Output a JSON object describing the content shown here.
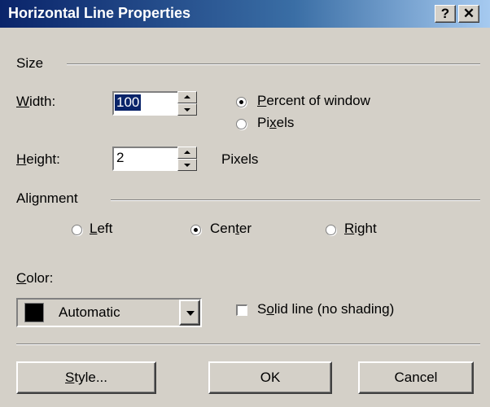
{
  "window": {
    "title": "Horizontal Line Properties",
    "help_label": "?",
    "close_label": "✕"
  },
  "size": {
    "section_label": "Size",
    "width_label_ul": "W",
    "width_label_rest": "idth:",
    "width_value": "100",
    "percent_ul": "P",
    "percent_rest": "ercent of window",
    "pixels_pre": "Pi",
    "pixels_ul": "x",
    "pixels_post": "els",
    "height_label_ul": "H",
    "height_label_rest": "eight:",
    "height_value": "2",
    "height_unit": "Pixels",
    "selected_unit": "percent"
  },
  "alignment": {
    "section_label": "Alignment",
    "left_ul": "L",
    "left_rest": "eft",
    "center_pre": "Cen",
    "center_ul": "t",
    "center_post": "er",
    "right_ul": "R",
    "right_rest": "ight",
    "selected": "center"
  },
  "color": {
    "label_ul": "C",
    "label_rest": "olor:",
    "value": "Automatic",
    "swatch": "#000000",
    "solid_pre": "S",
    "solid_ul": "o",
    "solid_post": "lid line (no shading)",
    "solid_checked": false
  },
  "buttons": {
    "style_ul": "S",
    "style_rest": "tyle...",
    "ok": "OK",
    "cancel": "Cancel"
  }
}
